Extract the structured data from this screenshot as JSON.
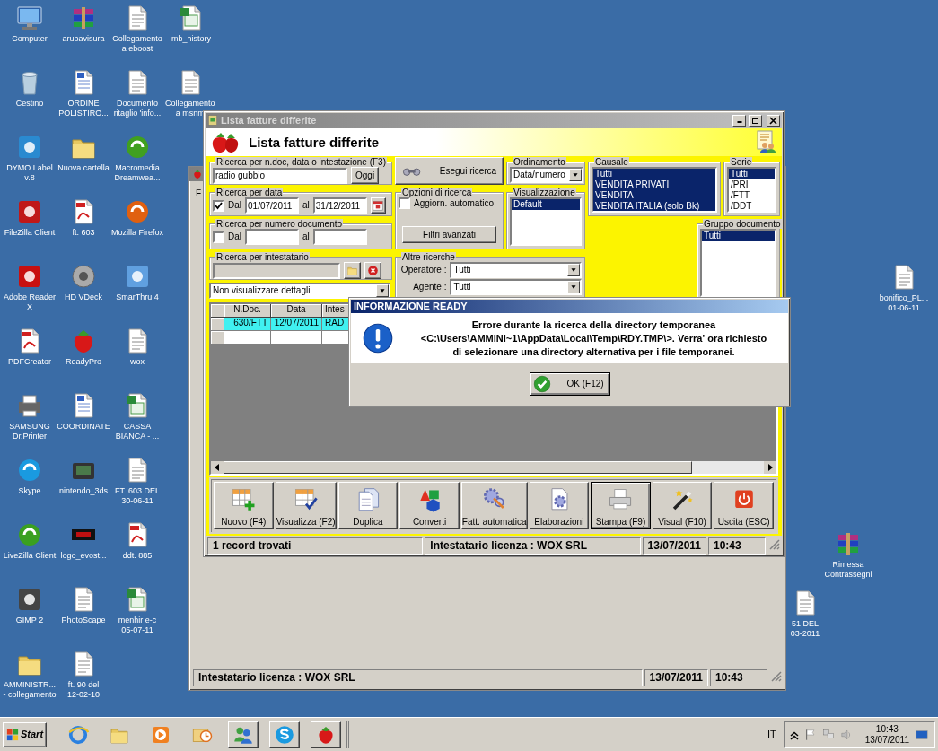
{
  "desktop": {
    "icon_columns": [
      [
        {
          "label": "Computer"
        },
        {
          "label": "Cestino"
        },
        {
          "label": "DYMO Label\nv.8"
        },
        {
          "label": "FileZilla Client"
        },
        {
          "label": "Adobe Reader\nX"
        },
        {
          "label": "PDFCreator"
        },
        {
          "label": "SAMSUNG\nDr.Printer"
        },
        {
          "label": "Skype"
        },
        {
          "label": "LiveZilla Client"
        },
        {
          "label": "GIMP 2"
        },
        {
          "label": "AMMINISTR...\n- collegamento"
        }
      ],
      [
        {
          "label": "arubavisura"
        },
        {
          "label": "ORDINE\nPOLISTIRO..."
        },
        {
          "label": "Nuova cartella"
        },
        {
          "label": "ft. 603"
        },
        {
          "label": "HD VDeck"
        },
        {
          "label": "ReadyPro"
        },
        {
          "label": "COORDINATE"
        },
        {
          "label": "nintendo_3ds"
        },
        {
          "label": "logo_evost..."
        },
        {
          "label": "PhotoScape"
        },
        {
          "label": "ft. 90 del\n12-02-10"
        }
      ],
      [
        {
          "label": "Collegamento\na eboost"
        },
        {
          "label": "Documento\nritaglio 'info..."
        },
        {
          "label": "Macromedia\nDreamwea..."
        },
        {
          "label": "Mozilla Firefox"
        },
        {
          "label": "SmarThru 4"
        },
        {
          "label": "wox"
        },
        {
          "label": "CASSA\nBIANCA - ..."
        },
        {
          "label": "FT. 603 DEL\n30-06-11"
        },
        {
          "label": "ddt. 885"
        },
        {
          "label": "menhir e-c\n05-07-11"
        }
      ],
      [
        {
          "label": "mb_history"
        },
        {
          "label": "Collegamento\na msnm"
        }
      ]
    ],
    "loose_icons": [
      {
        "label": "bonifico_PL...\n01-06-11"
      },
      {
        "label": "Rimessa\nContrassegni"
      },
      {
        "label": "51 DEL\n03-2011"
      }
    ]
  },
  "background_window": {
    "cut_label": "F",
    "status_bar": [
      "Intestatario licenza : WOX SRL",
      "13/07/2011",
      "10:43"
    ]
  },
  "main_window": {
    "title": "Lista fatture differite",
    "header_title": "Lista fatture differite",
    "text_search": {
      "legend": "Ricerca per n.doc, data o intestazione (F3)",
      "value": "radio gubbio",
      "button": "Oggi"
    },
    "date_search": {
      "legend": "Ricerca per data",
      "checked": true,
      "from_label": "Dal",
      "from": "01/07/2011",
      "to_label": "al",
      "to": "31/12/2011"
    },
    "number_search": {
      "legend": "Ricerca per numero documento",
      "checked": false,
      "from_label": "Dal",
      "to_label": "al"
    },
    "owner_search": {
      "legend": "Ricerca per intestatario"
    },
    "details_select": {
      "value": "Non visualizzare dettagli"
    },
    "search_button": "Esegui ricerca",
    "options": {
      "legend": "Opzioni di ricerca",
      "auto_update": {
        "label": "Aggiorn. automatico",
        "checked": false
      },
      "filters_button": "Filtri avanzati"
    },
    "other_searches": {
      "legend": "Altre ricerche",
      "fields": [
        {
          "label": "Operatore :",
          "value": "Tutti"
        },
        {
          "label": "Agente :",
          "value": "Tutti"
        }
      ]
    },
    "ordering": {
      "legend": "Ordinamento",
      "value": "Data/numero"
    },
    "view": {
      "legend": "Visualizzazione",
      "items": [
        {
          "label": "Default",
          "selected": true
        }
      ]
    },
    "causale": {
      "legend": "Causale",
      "items": [
        {
          "label": "Tutti",
          "selected": true
        },
        {
          "label": "VENDITA PRIVATI",
          "selected": true
        },
        {
          "label": "VENDITA",
          "selected": true
        },
        {
          "label": "VENDITA ITALIA (solo Bk)",
          "selected": true
        }
      ]
    },
    "series": {
      "legend": "Serie",
      "items": [
        {
          "label": "Tutti",
          "selected": true
        },
        {
          "label": "/PRI",
          "selected": false
        },
        {
          "label": "/FTT",
          "selected": false
        },
        {
          "label": "/DDT",
          "selected": false
        }
      ]
    },
    "doc_group": {
      "legend": "Gruppo documento",
      "items": [
        {
          "label": "Tutti",
          "selected": true
        }
      ]
    },
    "table": {
      "columns": [
        "N.Doc.",
        "Data",
        "Intes"
      ],
      "rows": [
        {
          "cells": [
            "630/FTT",
            "12/07/2011",
            "RAD"
          ],
          "selected": true
        }
      ]
    },
    "toolbar": [
      {
        "label": "Nuovo (F4)",
        "focused": false
      },
      {
        "label": "Visualizza (F2)",
        "focused": false
      },
      {
        "label": "Duplica",
        "focused": false
      },
      {
        "label": "Converti",
        "focused": false
      },
      {
        "label": "Fatt. automatica",
        "focused": false
      },
      {
        "label": "Elaborazioni",
        "focused": false
      },
      {
        "label": "Stampa (F9)",
        "focused": true
      },
      {
        "label": "Visual (F10)",
        "focused": false
      },
      {
        "label": "Uscita (ESC)",
        "focused": false
      }
    ],
    "status_bar": [
      "1 record trovati",
      "Intestatario licenza : WOX SRL",
      "13/07/2011",
      "10:43"
    ]
  },
  "dialog": {
    "title": "INFORMAZIONE READY",
    "message": "Errore durante la ricerca della directory temporanea\n<C:\\Users\\AMMINI~1\\AppData\\Local\\Temp\\RDY.TMP\\>. Verra' ora richiesto\ndi selezionare una directory alternativa per i file temporanei.",
    "button": "OK (F12)"
  },
  "taskbar": {
    "start": "Start",
    "language": "IT",
    "time": "10:43",
    "date": "13/07/2011"
  }
}
